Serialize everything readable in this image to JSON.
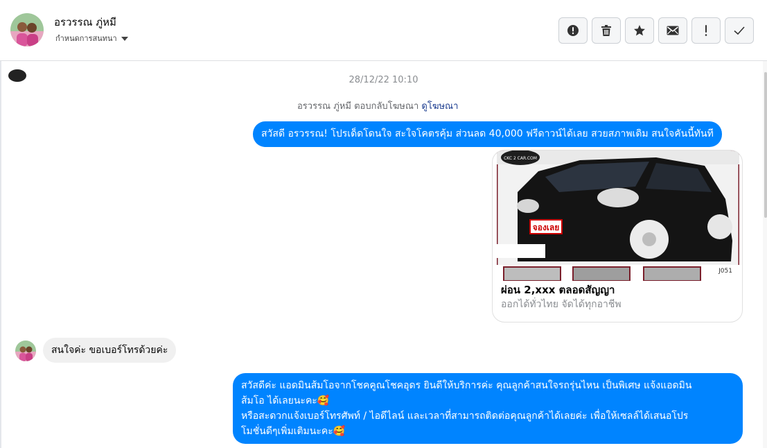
{
  "header": {
    "contact_name": "อรวรรณ ภู่หมี",
    "assign_label": "กำหนดการสนทนา",
    "toolbar": [
      {
        "name": "report-button",
        "icon": "alert-circle-icon"
      },
      {
        "name": "delete-button",
        "icon": "trash-icon"
      },
      {
        "name": "star-button",
        "icon": "star-icon"
      },
      {
        "name": "mark-unread-button",
        "icon": "envelope-icon"
      },
      {
        "name": "important-button",
        "icon": "exclamation-icon"
      },
      {
        "name": "done-button",
        "icon": "checkmark-icon"
      }
    ]
  },
  "conversation": {
    "timestamp": "28/12/22 10:10",
    "ad_reply": {
      "text": "อรวรรณ ภู่หมี ตอบกลับโฆษณา",
      "link": "ดูโฆษณา"
    },
    "messages": [
      {
        "direction": "out",
        "text": "สวัสดี อรวรรณ! โปรเด็ดโดนใจ สะใจโคตรคุ้ม ส่วนลด 40,000 ฟรีดาวน์ได้เลย สวยสภาพเดิม สนใจคันนี้ทันที"
      },
      {
        "direction": "in",
        "text": "สนใจค่ะ ขอเบอร์โทรด้วยค่ะ"
      },
      {
        "direction": "out",
        "lines": [
          "สวัสดีค่ะ แอดมินส้มโอจากโชคคูณโชคอุดร ยินดีให้บริการค่ะ   คุณลูกค้าสนใจรถรุ่นไหน เป็นพิเศษ แจ้งแอดมิน",
          "ส้มโอ ได้เลยนะคะ🥰",
          "หรือสะดวกแจ้งเบอร์โทรศัพท์ / ไอดีไลน์ และเวลาที่สามารถติดต่อคุณลูกค้าได้เลยค่ะ เพื่อให้เซลล์ได้เสนอโปร",
          "โมชั่นดีๆเพิ่มเติมนะคะ🥰"
        ]
      }
    ],
    "ad_card": {
      "title": "ผ่อน 2,xxx ตลอดสัญญา",
      "subtitle": "ออกได้ทั่วไทย จัดได้ทุกอาชีพ",
      "image": {
        "watermark": "CKC 2 CAR.COM",
        "badge": "จองเลย",
        "code": "J051"
      }
    }
  },
  "colors": {
    "outgoing_bubble": "#0084ff",
    "incoming_bubble": "#f0f0f0",
    "link": "#1a3b8f",
    "muted_text": "#8a8d91"
  }
}
